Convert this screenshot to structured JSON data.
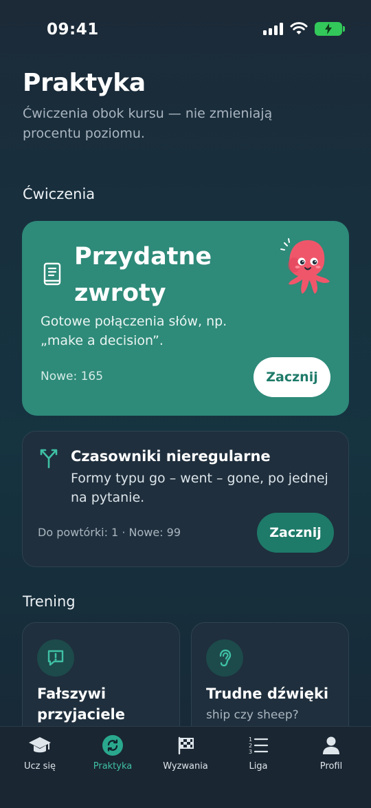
{
  "status_bar": {
    "time": "09:41"
  },
  "header": {
    "title": "Praktyka",
    "subtitle": "Ćwiczenia obok kursu — nie zmieniają procentu poziomu."
  },
  "sections": {
    "exercises": "Ćwiczenia",
    "training": "Trening"
  },
  "featured_card": {
    "title": "Przydatne zwroty",
    "description": "Gotowe połączenia słów, np. „make a decision”.",
    "count": "Nowe: 165",
    "button": "Zacznij",
    "icon": "book-icon"
  },
  "verb_card": {
    "title": "Czasowniki nieregularne",
    "description": "Formy typu go – went – gone, po jednej na pytanie.",
    "count": "Do powtórki: 1 · Nowe: 99",
    "button": "Zacznij",
    "icon": "fork-icon"
  },
  "training_cards": [
    {
      "title": "Fałszywi przyjaciele",
      "subtitle": "",
      "icon": "speech-alert-icon"
    },
    {
      "title": "Trudne dźwięki",
      "subtitle": "ship czy sheep?",
      "icon": "ear-icon"
    }
  ],
  "tabs": [
    {
      "label": "Ucz się",
      "icon": "graduation-cap-icon"
    },
    {
      "label": "Praktyka",
      "icon": "refresh-icon",
      "active": true
    },
    {
      "label": "Wyzwania",
      "icon": "checkered-flag-icon"
    },
    {
      "label": "Liga",
      "icon": "ranked-list-icon"
    },
    {
      "label": "Profil",
      "icon": "person-icon"
    }
  ],
  "colors": {
    "accent": "#2aa88d",
    "featured_card": "#2e8a79",
    "card": "#1f2f3d",
    "battery": "#33c85a",
    "mascot": "#f0566a"
  }
}
